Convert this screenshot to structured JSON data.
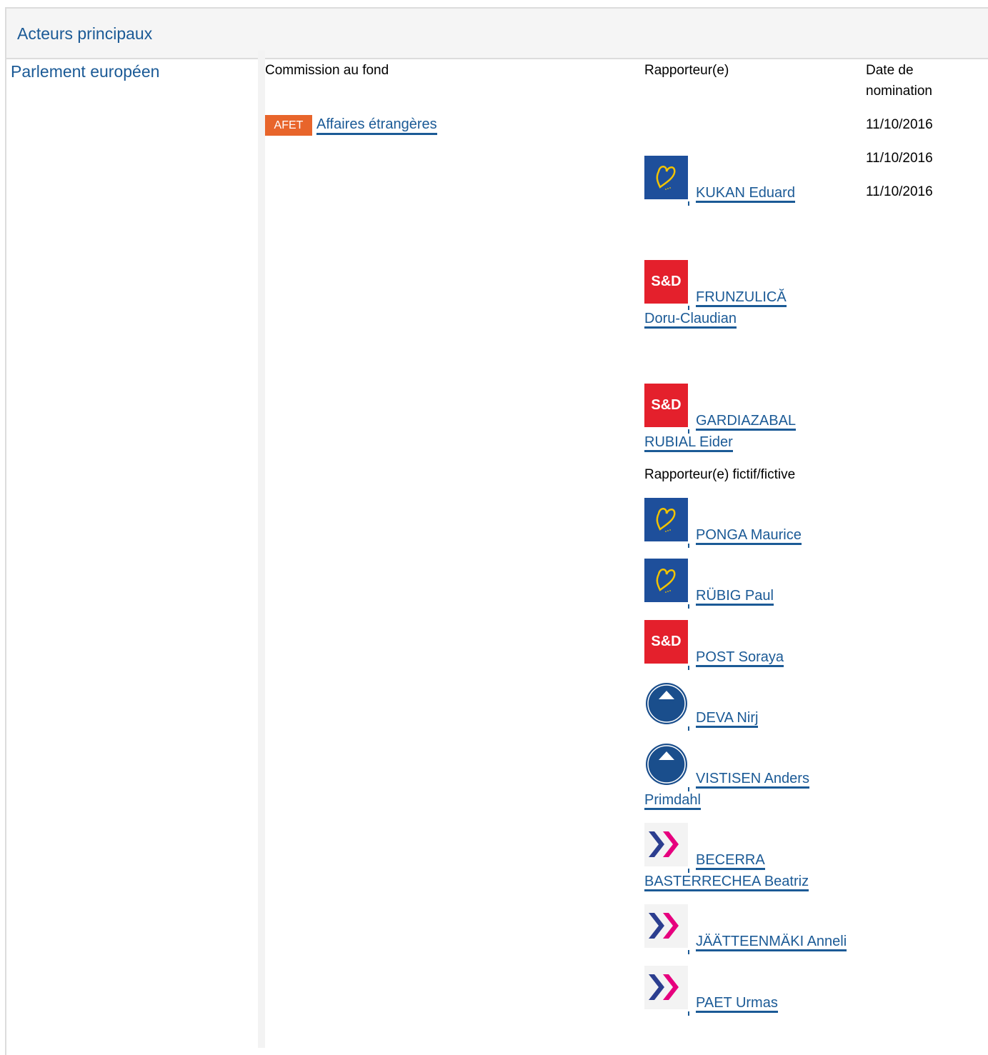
{
  "panel": {
    "title": "Acteurs principaux"
  },
  "institution": "Parlement européen",
  "headers": {
    "committee": "Commission au fond",
    "rapporteur": "Rapporteur(e)",
    "date_line1": "Date de",
    "date_line2": "nomination",
    "shadow": "Rapporteur(e) fictif/fictive"
  },
  "committee": {
    "code": "AFET",
    "name": "Affaires étrangères"
  },
  "dates": [
    "11/10/2016",
    "11/10/2016",
    "11/10/2016"
  ],
  "rapporteurs": [
    {
      "group": "epp",
      "line1": "KUKAN Eduard",
      "line2": ""
    },
    {
      "group": "sd",
      "line1": "FRUNZULICĂ",
      "line2": "Doru-Claudian"
    },
    {
      "group": "sd",
      "line1": "GARDIAZABAL",
      "line2": "RUBIAL Eider"
    }
  ],
  "shadows": [
    {
      "group": "epp",
      "line1": "PONGA Maurice",
      "line2": ""
    },
    {
      "group": "epp",
      "line1": "RÜBIG Paul",
      "line2": ""
    },
    {
      "group": "sd",
      "line1": "POST Soraya",
      "line2": ""
    },
    {
      "group": "ecr",
      "line1": "DEVA Nirj",
      "line2": ""
    },
    {
      "group": "ecr",
      "line1": "VISTISEN Anders",
      "line2": "Primdahl"
    },
    {
      "group": "renew",
      "line1": "BECERRA",
      "line2": "BASTERRECHEA Beatriz"
    },
    {
      "group": "renew",
      "line1": "JÄÄTTEENMÄKI Anneli",
      "line2": ""
    },
    {
      "group": "renew",
      "line1": "PAET Urmas",
      "line2": ""
    }
  ],
  "logo_text": {
    "sd": "S&D",
    "ecr": "ECR"
  },
  "colors": {
    "link": "#1b5a96",
    "tag": "#e8652b",
    "sd": "#e4202c",
    "epp": "#1e4f9b",
    "ecr": "#1a4e8c"
  }
}
